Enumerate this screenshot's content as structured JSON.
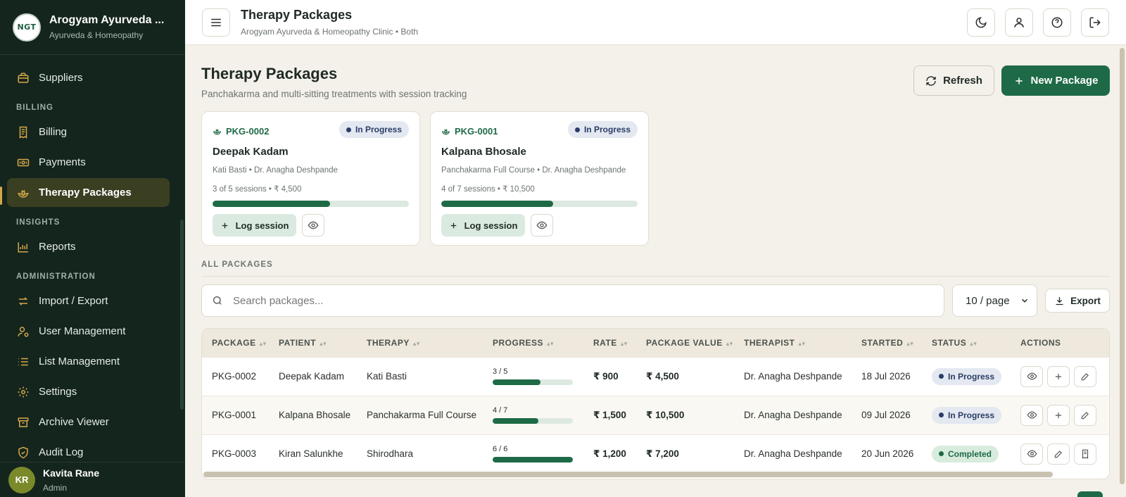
{
  "brand": {
    "name": "Arogyam Ayurveda ...",
    "subtitle": "Ayurveda & Homeopathy",
    "logo_text": "NGT"
  },
  "sidebar": {
    "items_top": [
      {
        "label": "Suppliers",
        "icon": "briefcase-icon"
      }
    ],
    "billing_title": "BILLING",
    "billing_items": [
      {
        "label": "Billing",
        "icon": "receipt-icon"
      },
      {
        "label": "Payments",
        "icon": "cash-icon"
      },
      {
        "label": "Therapy Packages",
        "icon": "lotus-icon",
        "active": true
      }
    ],
    "insights_title": "INSIGHTS",
    "insights_items": [
      {
        "label": "Reports",
        "icon": "chart-icon"
      }
    ],
    "admin_title": "ADMINISTRATION",
    "admin_items": [
      {
        "label": "Import / Export",
        "icon": "swap-icon"
      },
      {
        "label": "User Management",
        "icon": "user-gear-icon"
      },
      {
        "label": "List Management",
        "icon": "list-icon"
      },
      {
        "label": "Settings",
        "icon": "gear-icon"
      },
      {
        "label": "Archive Viewer",
        "icon": "archive-icon"
      },
      {
        "label": "Audit Log",
        "icon": "shield-check-icon"
      }
    ]
  },
  "user": {
    "initials": "KR",
    "name": "Kavita Rane",
    "role": "Admin"
  },
  "topbar": {
    "title": "Therapy Packages",
    "subtitle": "Arogyam Ayurveda & Homeopathy Clinic • Both"
  },
  "page": {
    "title": "Therapy Packages",
    "subtitle": "Panchakarma and multi-sitting treatments with session tracking",
    "refresh_label": "Refresh",
    "new_label": "New Package"
  },
  "cards": [
    {
      "code": "PKG-0002",
      "status": "In Progress",
      "patient": "Deepak Kadam",
      "meta": "Kati Basti • Dr. Anagha Deshpande",
      "sessions": "3 of 5 sessions • ₹ 4,500",
      "progress": 0.6,
      "log_label": "Log session"
    },
    {
      "code": "PKG-0001",
      "status": "In Progress",
      "patient": "Kalpana Bhosale",
      "meta": "Panchakarma Full Course • Dr. Anagha Deshpande",
      "sessions": "4 of 7 sessions • ₹ 10,500",
      "progress": 0.571,
      "log_label": "Log session"
    }
  ],
  "all_packages_label": "ALL PACKAGES",
  "search": {
    "placeholder": "Search packages..."
  },
  "perpage": {
    "value": "10 / page"
  },
  "export_label": "Export",
  "table": {
    "headers": [
      "PACKAGE",
      "PATIENT",
      "THERAPY",
      "PROGRESS",
      "RATE",
      "PACKAGE VALUE",
      "THERAPIST",
      "STARTED",
      "STATUS",
      "ACTIONS"
    ],
    "rows": [
      {
        "package": "PKG-0002",
        "patient": "Deepak Kadam",
        "therapy": "Kati Basti",
        "progress_label": "3 / 5",
        "progress": 0.6,
        "rate": "₹ 900",
        "value": "₹ 4,500",
        "therapist": "Dr. Anagha Deshpande",
        "started": "18 Jul 2026",
        "status": "In Progress",
        "status_kind": "progress"
      },
      {
        "package": "PKG-0001",
        "patient": "Kalpana Bhosale",
        "therapy": "Panchakarma Full Course",
        "progress_label": "4 / 7",
        "progress": 0.571,
        "rate": "₹ 1,500",
        "value": "₹ 10,500",
        "therapist": "Dr. Anagha Deshpande",
        "started": "09 Jul 2026",
        "status": "In Progress",
        "status_kind": "progress"
      },
      {
        "package": "PKG-0003",
        "patient": "Kiran Salunkhe",
        "therapy": "Shirodhara",
        "progress_label": "6 / 6",
        "progress": 1.0,
        "rate": "₹ 1,200",
        "value": "₹ 7,200",
        "therapist": "Dr. Anagha Deshpande",
        "started": "20 Jun 2026",
        "status": "Completed",
        "status_kind": "done"
      }
    ]
  },
  "colors": {
    "accent": "#1e6a46",
    "sidebar": "#14251d",
    "gold": "#d4a84a"
  }
}
